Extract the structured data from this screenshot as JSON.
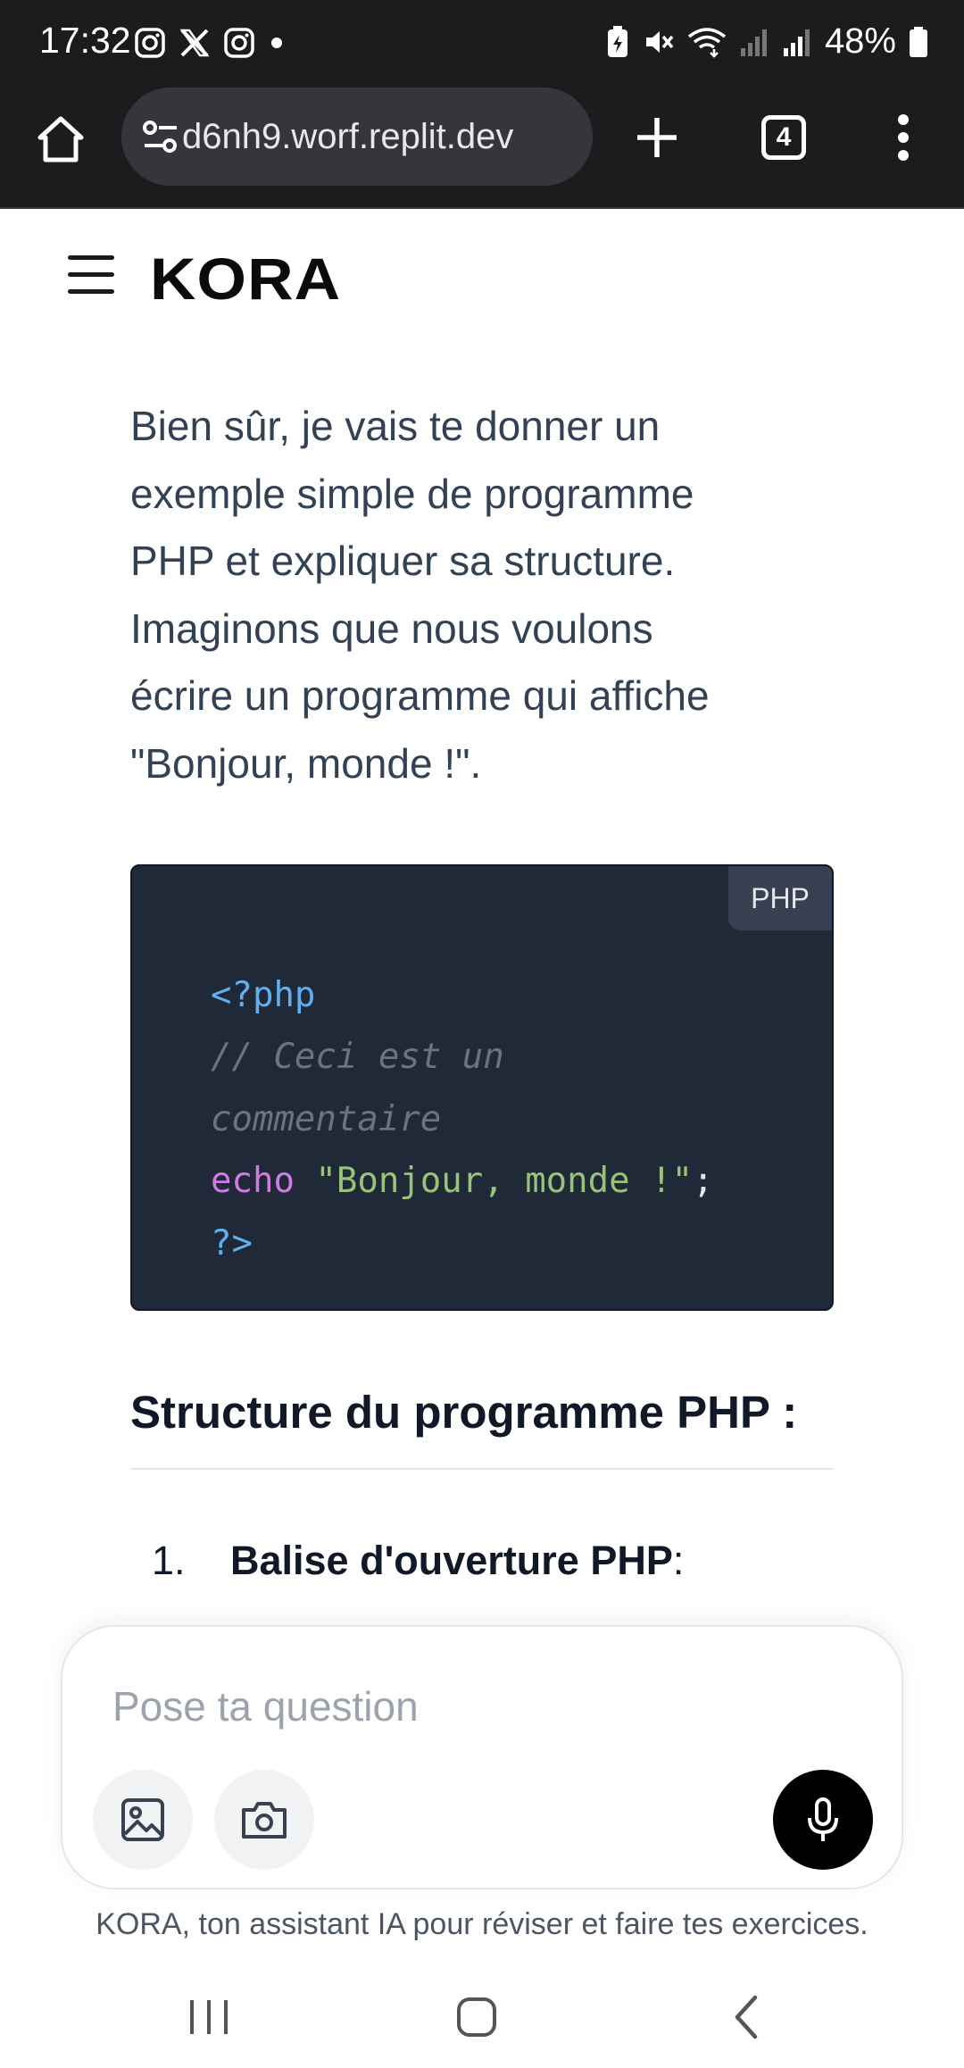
{
  "status_bar": {
    "time": "17:32",
    "battery": "48%",
    "notification_icons": [
      "instagram-icon",
      "x-icon",
      "instagram-icon",
      "dot-icon"
    ],
    "system_icons": [
      "battery-saver-icon",
      "mute-icon",
      "wifi-icon",
      "signal-icon",
      "signal-icon",
      "battery-icon"
    ]
  },
  "browser": {
    "url": "d6nh9.worf.replit.dev",
    "tab_count": "4"
  },
  "app": {
    "logo": "KORA"
  },
  "message": {
    "intro_lines": [
      "Bien sûr, je vais te donner un",
      "exemple simple de programme",
      "PHP et expliquer sa structure.",
      "Imaginons que nous voulons",
      "écrire un programme qui affiche",
      "\"Bonjour, monde !\"."
    ],
    "code": {
      "language": "PHP",
      "open_tag": "<?php",
      "comment_line1": "// Ceci est un",
      "comment_line2": "commentaire",
      "keyword": "echo",
      "string": "\"Bonjour, monde !\"",
      "semicolon": ";",
      "close_tag": "?>"
    },
    "section_title": "Structure du programme PHP :",
    "list": [
      {
        "number": "1.",
        "text": "Balise d'ouverture PHP",
        "suffix": " :"
      }
    ]
  },
  "composer": {
    "placeholder": "Pose ta question",
    "disclaimer": "KORA, ton assistant IA pour réviser et faire tes exercices."
  },
  "colors": {
    "chrome_bg": "#1c1c1f",
    "url_pill": "#35363b",
    "code_bg": "#1f2937",
    "text_body": "#334155",
    "mic_button": "#000000"
  }
}
